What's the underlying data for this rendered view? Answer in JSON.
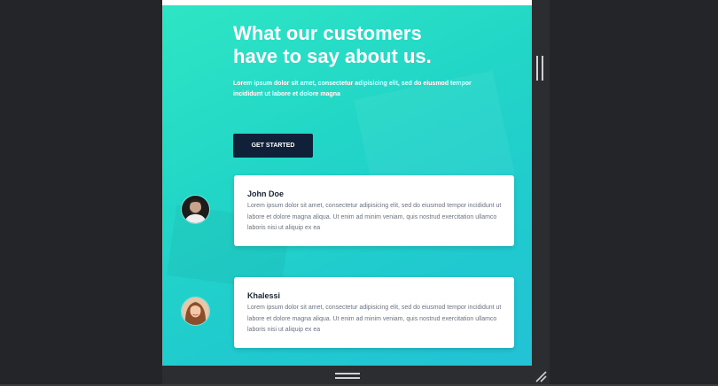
{
  "hero": {
    "headline": "What our customers have to say about us.",
    "subheadline": "Lorem ipsum dolor sit amet, consectetur adipisicing elit, sed do eiusmod tempor incididunt ut labore et dolore magna",
    "cta_label": "GET STARTED"
  },
  "testimonials": [
    {
      "name": "John Doe",
      "text": "Lorem ipsum dolor sit amet, consectetur adipisicing elit, sed do eiusmod tempor incididunt ut labore et dolore magna aliqua. Ut enim ad minim veniam, quis nostrud exercitation ullamco laboris nisi ut aliquip ex ea"
    },
    {
      "name": "Khalessi",
      "text": "Lorem ipsum dolor sit amet, consectetur adipisicing elit, sed do eiusmod tempor incididunt ut labore et dolore magna aliqua. Ut enim ad minim veniam, quis nostrud exercitation ullamco laboris nisi ut aliquip ex ea"
    }
  ],
  "colors": {
    "gradient_start": "#2ee6c4",
    "gradient_end": "#23c2d6",
    "button": "#0f2038",
    "editor_bg": "#242528"
  },
  "icons": [
    "vertical-resize-grip-icon",
    "horizontal-resize-grip-icon",
    "corner-resize-icon"
  ]
}
